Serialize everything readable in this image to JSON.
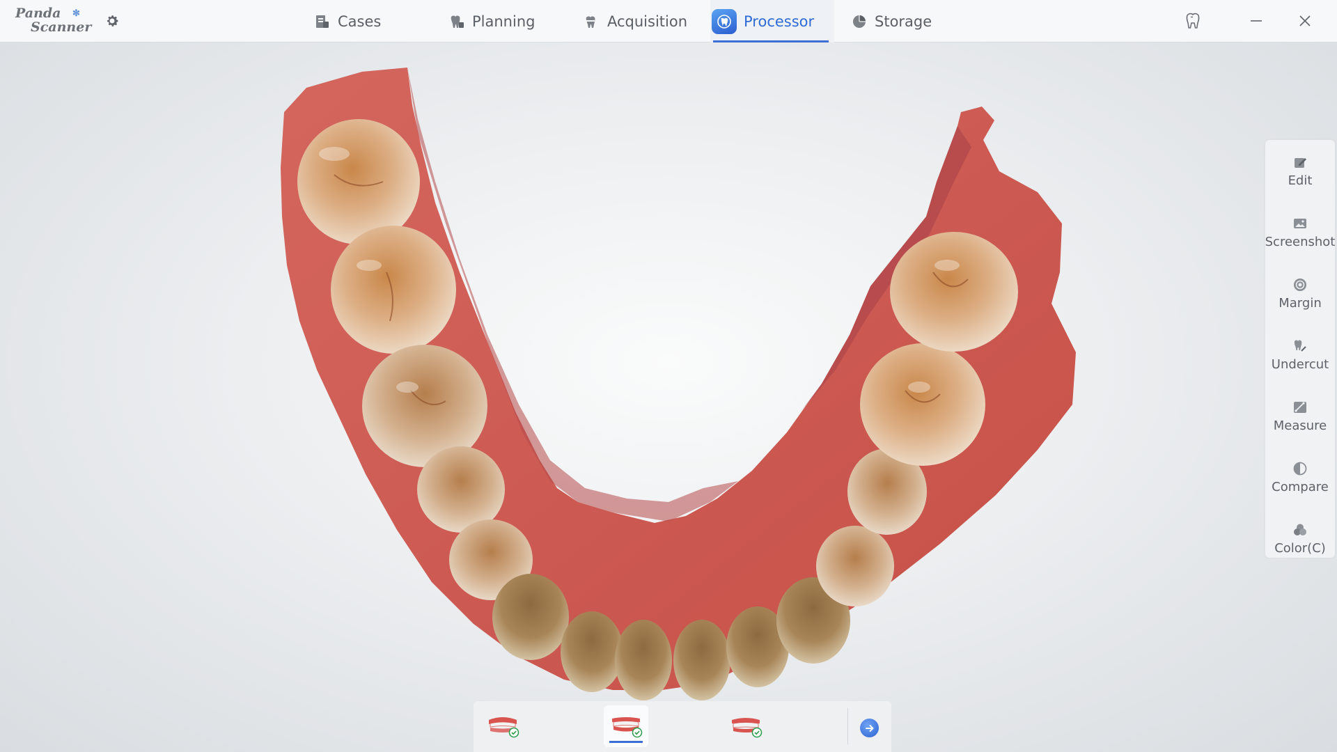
{
  "app": {
    "logo_line1": "Panda",
    "logo_line2": "Scanner"
  },
  "nav": {
    "tabs": [
      {
        "label": "Cases",
        "icon": "cases-icon"
      },
      {
        "label": "Planning",
        "icon": "planning-icon"
      },
      {
        "label": "Acquisition",
        "icon": "acquisition-icon"
      },
      {
        "label": "Processor",
        "icon": "processor-icon",
        "active": true
      },
      {
        "label": "Storage",
        "icon": "storage-icon"
      }
    ]
  },
  "tools": [
    {
      "label": "Edit",
      "icon": "edit-icon"
    },
    {
      "label": "Screenshot",
      "icon": "screenshot-icon"
    },
    {
      "label": "Margin",
      "icon": "margin-icon"
    },
    {
      "label": "Undercut",
      "icon": "undercut-icon"
    },
    {
      "label": "Measure",
      "icon": "measure-icon"
    },
    {
      "label": "Compare",
      "icon": "compare-icon"
    },
    {
      "label": "Color(C)",
      "icon": "color-icon"
    }
  ],
  "bottom": {
    "jaws": [
      {
        "name": "upper-jaw",
        "checked": true
      },
      {
        "name": "lower-jaw",
        "checked": true,
        "active": true
      },
      {
        "name": "bite",
        "checked": true
      }
    ]
  },
  "colors": {
    "accent": "#2f6bd6",
    "gum": "#c8554f",
    "tooth": "#d9a77a"
  }
}
